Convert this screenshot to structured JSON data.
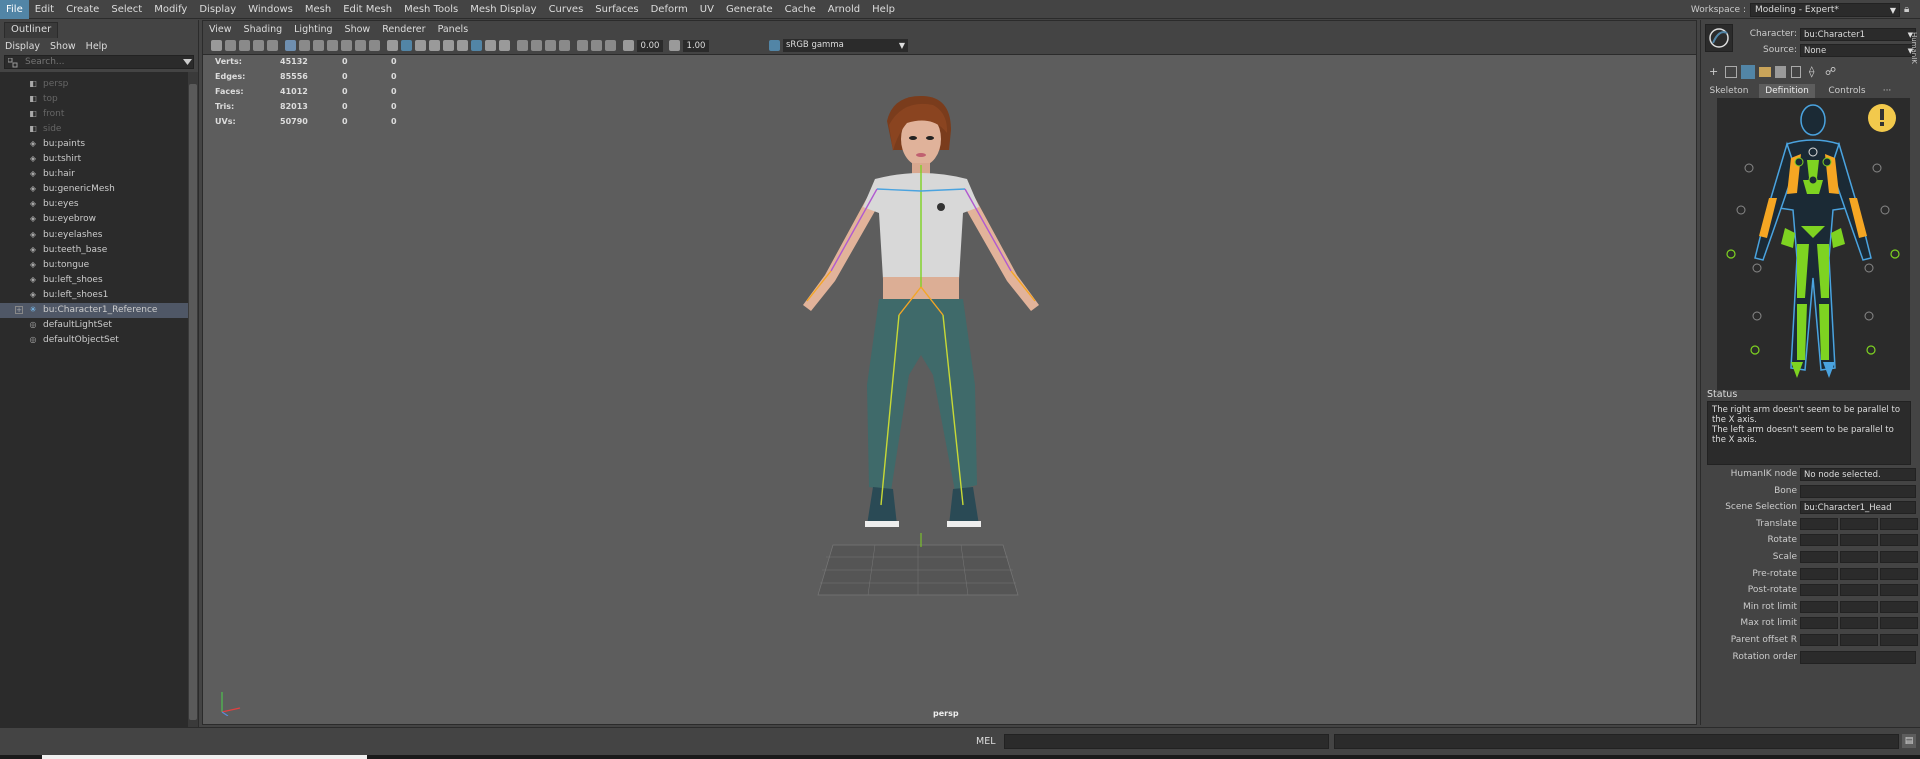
{
  "menubar": {
    "items": [
      "File",
      "Edit",
      "Create",
      "Select",
      "Modify",
      "Display",
      "Windows",
      "Mesh",
      "Edit Mesh",
      "Mesh Tools",
      "Mesh Display",
      "Curves",
      "Surfaces",
      "Deform",
      "UV",
      "Generate",
      "Cache",
      "Arnold",
      "Help"
    ],
    "active": "File",
    "workspace_label": "Workspace :",
    "workspace_value": "Modeling - Expert*"
  },
  "outliner": {
    "tab": "Outliner",
    "menu": [
      "Display",
      "Show",
      "Help"
    ],
    "search_placeholder": "Search...",
    "items": [
      {
        "label": "persp",
        "icon": "camera-icon",
        "dim": true
      },
      {
        "label": "top",
        "icon": "camera-icon",
        "dim": true
      },
      {
        "label": "front",
        "icon": "camera-icon",
        "dim": true
      },
      {
        "label": "side",
        "icon": "camera-icon",
        "dim": true
      },
      {
        "label": "bu:paints",
        "icon": "mesh-icon",
        "dim": false
      },
      {
        "label": "bu:tshirt",
        "icon": "mesh-icon",
        "dim": false
      },
      {
        "label": "bu:hair",
        "icon": "mesh-icon",
        "dim": false
      },
      {
        "label": "bu:genericMesh",
        "icon": "mesh-icon",
        "dim": false
      },
      {
        "label": "bu:eyes",
        "icon": "mesh-icon",
        "dim": false
      },
      {
        "label": "bu:eyebrow",
        "icon": "mesh-icon",
        "dim": false
      },
      {
        "label": "bu:eyelashes",
        "icon": "mesh-icon",
        "dim": false
      },
      {
        "label": "bu:teeth_base",
        "icon": "mesh-icon",
        "dim": false
      },
      {
        "label": "bu:tongue",
        "icon": "mesh-icon",
        "dim": false
      },
      {
        "label": "bu:left_shoes",
        "icon": "mesh-icon",
        "dim": false
      },
      {
        "label": "bu:left_shoes1",
        "icon": "mesh-icon",
        "dim": false
      },
      {
        "label": "bu:Character1_Reference",
        "icon": "joint-icon",
        "dim": false,
        "selected": true,
        "expandable": true
      },
      {
        "label": "defaultLightSet",
        "icon": "set-icon",
        "dim": false
      },
      {
        "label": "defaultObjectSet",
        "icon": "set-icon",
        "dim": false
      }
    ]
  },
  "viewport": {
    "menu": [
      "View",
      "Shading",
      "Lighting",
      "Show",
      "Renderer",
      "Panels"
    ],
    "exposure": "0.00",
    "gamma": "1.00",
    "colorspace": "sRGB gamma",
    "camera": "persp",
    "hud": [
      {
        "label": "Verts:",
        "v1": "45132",
        "v2": "0",
        "v3": "0"
      },
      {
        "label": "Edges:",
        "v1": "85556",
        "v2": "0",
        "v3": "0"
      },
      {
        "label": "Faces:",
        "v1": "41012",
        "v2": "0",
        "v3": "0"
      },
      {
        "label": "Tris:",
        "v1": "82013",
        "v2": "0",
        "v3": "0"
      },
      {
        "label": "UVs:",
        "v1": "50790",
        "v2": "0",
        "v3": "0"
      }
    ]
  },
  "humanik": {
    "character_label": "Character:",
    "character_value": "bu:Character1",
    "source_label": "Source:",
    "source_value": "None",
    "side_tab": "HumanIK",
    "tabs": [
      "Skeleton",
      "Definition",
      "Controls"
    ],
    "active_tab": "Definition",
    "status_title": "Status",
    "status_lines": [
      "The right arm doesn't seem to be parallel to the X axis.",
      "The left arm doesn't seem to be parallel to the X axis."
    ],
    "props": [
      {
        "label": "HumanIK node",
        "value": "No node selected."
      },
      {
        "label": "Bone",
        "value": ""
      },
      {
        "label": "Scene Selection",
        "value": "bu:Character1_Head"
      },
      {
        "label": "Translate",
        "value": null
      },
      {
        "label": "Rotate",
        "value": null
      },
      {
        "label": "Scale",
        "value": null
      },
      {
        "label": "Pre-rotate",
        "value": null
      },
      {
        "label": "Post-rotate",
        "value": null
      },
      {
        "label": "Min rot limit",
        "value": null
      },
      {
        "label": "Max rot limit",
        "value": null
      },
      {
        "label": "Parent offset R",
        "value": null
      },
      {
        "label": "Rotation order",
        "value": ""
      }
    ]
  },
  "commandline": {
    "mel_label": "MEL"
  },
  "colors": {
    "accent": "#5285a6",
    "warning": "#f2c94c",
    "bone_green": "#7ed321",
    "bone_yellow": "#f5a623",
    "bone_blue": "#4aa3df"
  }
}
